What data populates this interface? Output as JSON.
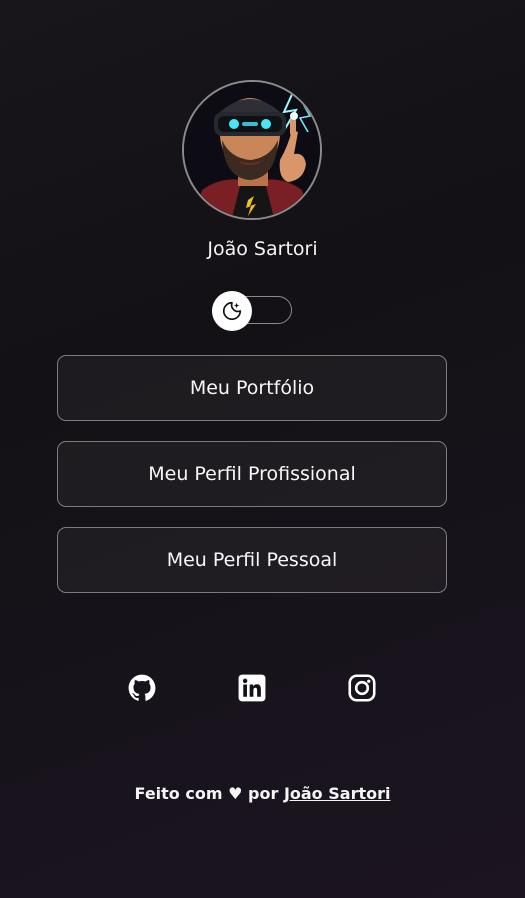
{
  "profile": {
    "name": "João Sartori",
    "avatar_icon": "avatar-vr-portrait"
  },
  "theme_toggle": {
    "icon": "moon-sparkle-icon",
    "state": "dark"
  },
  "links": [
    {
      "label": "Meu Portfólio"
    },
    {
      "label": "Meu Perfil Profissional"
    },
    {
      "label": "Meu Perfil Pessoal"
    }
  ],
  "social": [
    {
      "icon": "github-icon"
    },
    {
      "icon": "linkedin-icon"
    },
    {
      "icon": "instagram-icon"
    }
  ],
  "footer": {
    "prefix": "Feito com",
    "heart": "♥",
    "middle": "por",
    "author_link": "João Sartori"
  },
  "colors": {
    "background": "#141216",
    "button_border": "#7d7b80",
    "text": "#f5f5f5"
  }
}
